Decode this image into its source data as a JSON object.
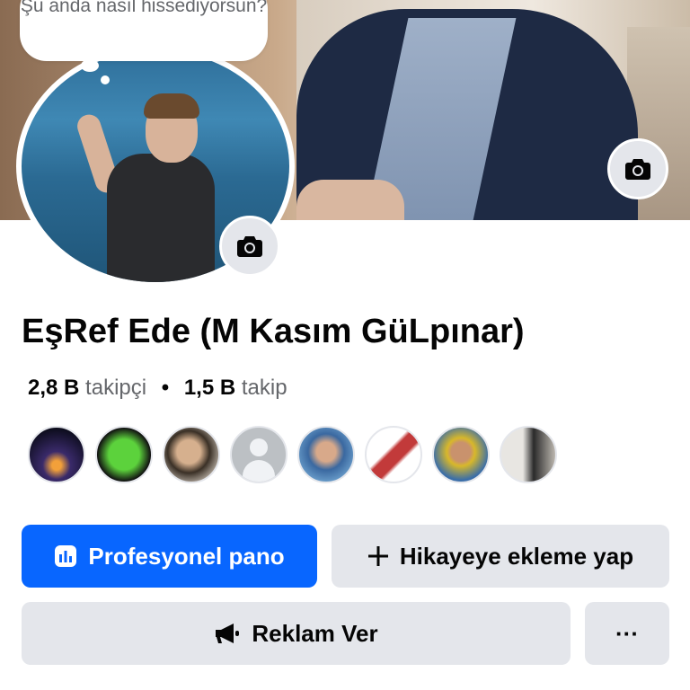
{
  "status_bubble": {
    "text": "Şu anda nasıl hissediyorsun?"
  },
  "profile": {
    "name": "EşRef Ede (M Kasım GüLpınar)",
    "followers_count": "2,8 B",
    "followers_label": "takipçi",
    "following_count": "1,5 B",
    "following_label": "takip",
    "separator": "•"
  },
  "icons": {
    "cover_camera": "camera-icon",
    "avatar_camera": "camera-icon",
    "dashboard": "bar-chart-icon",
    "add": "plus-icon",
    "ads": "megaphone-icon",
    "more": "more-dots-icon"
  },
  "actions": {
    "professional_dashboard": "Profesyonel pano",
    "add_to_story": "Hikayeye ekleme yap",
    "advertise": "Reklam Ver",
    "more": "···"
  },
  "colors": {
    "primary": "#0866ff",
    "secondary_button": "#e4e6eb",
    "text_primary": "#050505",
    "text_secondary": "#65676b"
  }
}
